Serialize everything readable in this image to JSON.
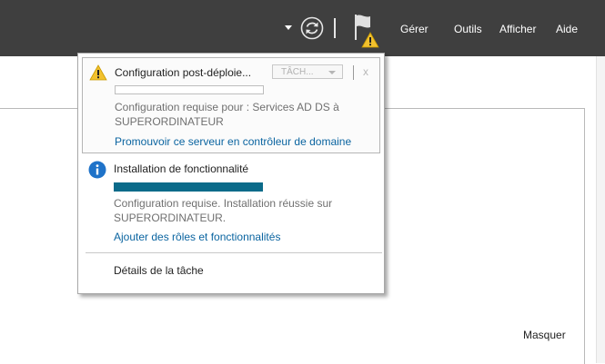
{
  "toolbar": {
    "menu": [
      "Gérer",
      "Outils",
      "Afficher",
      "Aide"
    ],
    "icons": [
      "dropdown-arrow-icon",
      "refresh-icon",
      "notification-flag-icon",
      "warning-icon"
    ]
  },
  "notifications": [
    {
      "severity": "warning",
      "title": "Configuration post-déploie...",
      "task_dropdown": "TÂCH...",
      "close": "x",
      "progress": 0,
      "message": "Configuration requise pour : Services AD DS à SUPERORDINATEUR",
      "link": "Promouvoir ce serveur en contrôleur de domaine"
    },
    {
      "severity": "info",
      "title": "Installation de fonctionnalité",
      "progress": 1,
      "message": "Configuration requise. Installation réussie sur SUPERORDINATEUR.",
      "link": "Ajouter des rôles et fonctionnalités"
    }
  ],
  "task_details": "Détails de la tâche",
  "background": {
    "hide_link": "Masquer"
  },
  "colors": {
    "toolbar_bg": "#3f3f3f",
    "accent": "#0b6b8a",
    "link": "#0a64a0",
    "warning": "#f2c12e"
  }
}
